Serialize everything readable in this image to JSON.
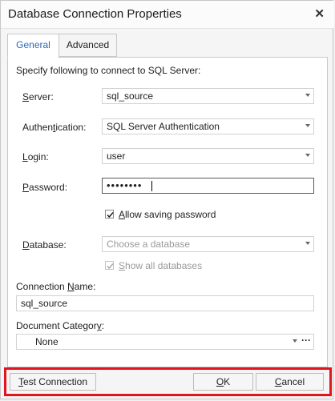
{
  "window": {
    "title": "Database Connection Properties",
    "close_glyph": "✕"
  },
  "tabs": [
    {
      "label": "General",
      "active": true
    },
    {
      "label": "Advanced",
      "active": false
    }
  ],
  "intro": "Specify following to connect to SQL Server:",
  "server": {
    "label_pre": "",
    "label_ul": "S",
    "label_post": "erver:",
    "value": "sql_source"
  },
  "authentication": {
    "label_pre": "Authen",
    "label_ul": "t",
    "label_post": "ication:",
    "value": "SQL Server Authentication"
  },
  "login": {
    "label_pre": "",
    "label_ul": "L",
    "label_post": "ogin:",
    "value": "user"
  },
  "password": {
    "label_pre": "",
    "label_ul": "P",
    "label_post": "assword:",
    "mask": "••••••••"
  },
  "allow_saving_password": {
    "label_pre": "",
    "label_ul": "A",
    "label_post": "llow saving password",
    "checked": true
  },
  "database": {
    "label_pre": "",
    "label_ul": "D",
    "label_post": "atabase:",
    "placeholder": "Choose a database"
  },
  "show_all_databases": {
    "label_pre": "",
    "label_ul": "S",
    "label_post": "how all databases",
    "checked": true,
    "disabled": true
  },
  "connection_name": {
    "label_pre": "Connection ",
    "label_ul": "N",
    "label_post": "ame:",
    "value": "sql_source"
  },
  "document_category": {
    "label_pre": "Document Categor",
    "label_ul": "y",
    "label_post": ":",
    "value": "None",
    "ellipsis": "···"
  },
  "footer": {
    "test_connection": {
      "pre": "",
      "ul": "T",
      "post": "est Connection"
    },
    "ok": {
      "pre": "",
      "ul": "O",
      "post": "K"
    },
    "cancel": {
      "pre": "",
      "ul": "C",
      "post": "ancel"
    }
  },
  "colors": {
    "active_tab": "#2b68b5",
    "highlight_border": "#e0151f"
  }
}
